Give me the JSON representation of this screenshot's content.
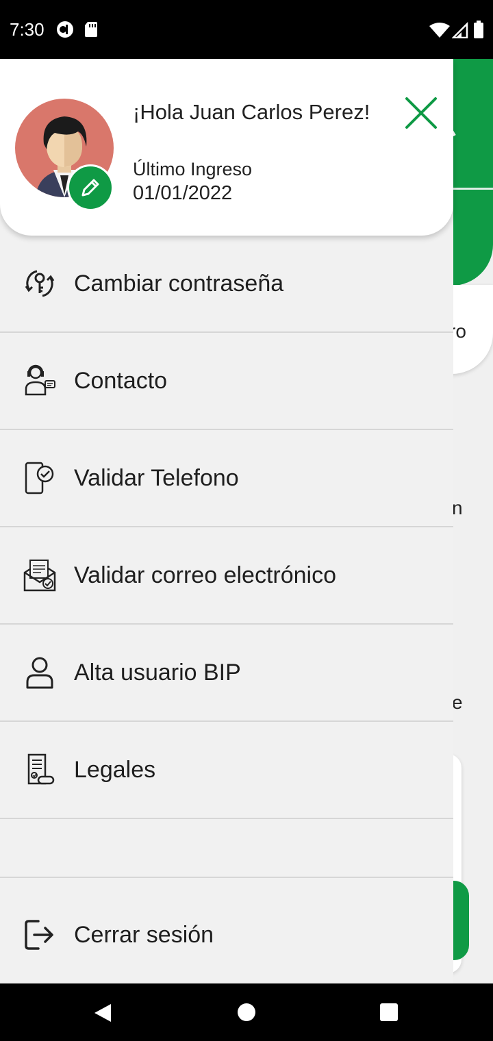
{
  "status_bar": {
    "time": "7:30"
  },
  "background": {
    "partial_text_1": "ro",
    "partial_text_2": "n",
    "partial_text_3": "e"
  },
  "header": {
    "greeting": "¡Hola Juan Carlos Perez!",
    "last_login_label": "Último Ingreso",
    "last_login_date": "01/01/2022"
  },
  "menu": {
    "items": [
      {
        "label": "Cambiar contraseña",
        "icon": "key-refresh-icon"
      },
      {
        "label": "Contacto",
        "icon": "support-agent-icon"
      },
      {
        "label": "Validar Telefono",
        "icon": "phone-check-icon"
      },
      {
        "label": "Validar correo electrónico",
        "icon": "mail-check-icon"
      },
      {
        "label": "Alta usuario BIP",
        "icon": "user-icon"
      },
      {
        "label": "Legales",
        "icon": "document-icon"
      }
    ],
    "logout": {
      "label": "Cerrar sesión",
      "icon": "logout-icon"
    }
  },
  "colors": {
    "brand_green": "#0f9a45",
    "avatar_bg": "#d9776b"
  }
}
